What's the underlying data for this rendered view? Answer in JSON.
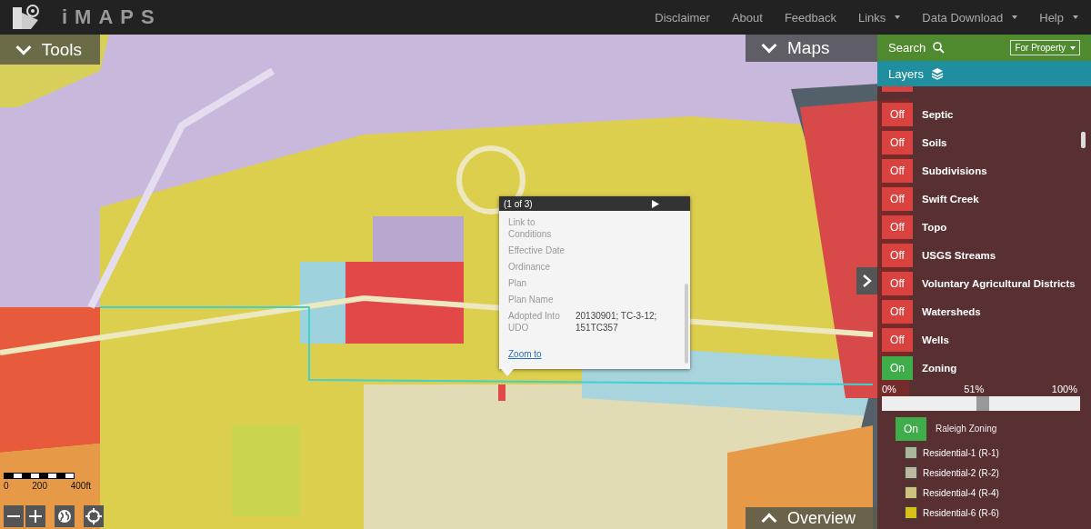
{
  "nav": {
    "brand": "iMAPS",
    "links": [
      {
        "label": "Disclaimer",
        "dropdown": false
      },
      {
        "label": "About",
        "dropdown": false
      },
      {
        "label": "Feedback",
        "dropdown": false
      },
      {
        "label": "Links",
        "dropdown": true
      },
      {
        "label": "Data Download",
        "dropdown": true
      },
      {
        "label": "Help",
        "dropdown": true
      }
    ]
  },
  "tools_tab": {
    "label": "Tools"
  },
  "maps_tab": {
    "label": "Maps"
  },
  "overview_tab": {
    "label": "Overview"
  },
  "search": {
    "label": "Search",
    "scope": "For Property"
  },
  "layers": {
    "title": "Layers",
    "items": [
      {
        "state_label": "Off",
        "on": false,
        "name": "Septic"
      },
      {
        "state_label": "Off",
        "on": false,
        "name": "Soils"
      },
      {
        "state_label": "Off",
        "on": false,
        "name": "Subdivisions"
      },
      {
        "state_label": "Off",
        "on": false,
        "name": "Swift Creek"
      },
      {
        "state_label": "Off",
        "on": false,
        "name": "Topo"
      },
      {
        "state_label": "Off",
        "on": false,
        "name": "USGS Streams"
      },
      {
        "state_label": "Off",
        "on": false,
        "name": "Voluntary Agricultural Districts"
      },
      {
        "state_label": "Off",
        "on": false,
        "name": "Watersheds"
      },
      {
        "state_label": "Off",
        "on": false,
        "name": "Wells"
      },
      {
        "state_label": "On",
        "on": true,
        "name": "Zoning"
      }
    ]
  },
  "opacity": {
    "min_label": "0%",
    "value_label": "51%",
    "max_label": "100%",
    "level": 0.51
  },
  "sublayer": {
    "state_label": "On",
    "on": true,
    "name": "Raleigh Zoning"
  },
  "legend": [
    {
      "label": "Residential-1 (R-1)",
      "color": "#a9b79a"
    },
    {
      "label": "Residential-2 (R-2)",
      "color": "#b9b8a0"
    },
    {
      "label": "Residential-4 (R-4)",
      "color": "#cfc47e"
    },
    {
      "label": "Residential-6 (R-6)",
      "color": "#d8c21a"
    }
  ],
  "popup": {
    "title": "(1 of 3)",
    "fields": [
      {
        "label": "Link to Conditions"
      },
      {
        "label": "Effective Date"
      },
      {
        "label": "Ordinance"
      },
      {
        "label": "Plan"
      },
      {
        "label": "Plan Name"
      },
      {
        "label": "Adopted Into UDO",
        "value": "20130901; TC-3-12; 151TC357"
      }
    ],
    "link": "Zoom to"
  },
  "scale": {
    "labels": [
      "0",
      "200",
      "400ft"
    ]
  }
}
